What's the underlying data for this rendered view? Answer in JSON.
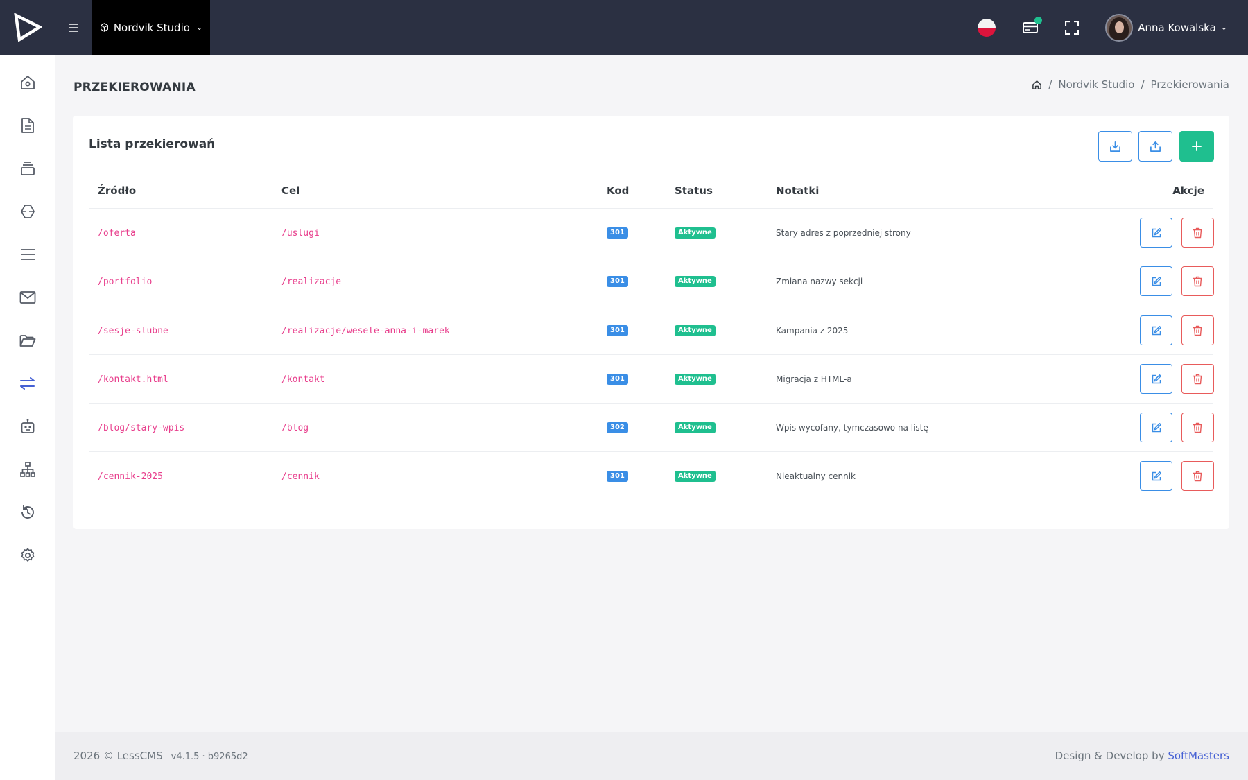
{
  "topbar": {
    "site_name": "Nordvik Studio",
    "user_name": "Anna Kowalska",
    "icons": [
      "logo-icon",
      "menu-icon",
      "cube-icon",
      "flag-pl-icon",
      "card-icon",
      "fullscreen-icon",
      "chevron-down-icon"
    ],
    "accent": "#1fbf8f"
  },
  "sidebar": {
    "items": [
      {
        "name": "home"
      },
      {
        "name": "pages"
      },
      {
        "name": "layers"
      },
      {
        "name": "modules"
      },
      {
        "name": "menu"
      },
      {
        "name": "mail"
      },
      {
        "name": "files"
      },
      {
        "name": "redirects",
        "active": true
      },
      {
        "name": "robot"
      },
      {
        "name": "sitemap"
      },
      {
        "name": "history"
      },
      {
        "name": "settings"
      }
    ]
  },
  "page": {
    "title": "PRZEKIEROWANIA",
    "breadcrumb": [
      "Nordvik Studio",
      "Przekierowania"
    ]
  },
  "card": {
    "title": "Lista przekierowań",
    "columns": [
      "Źródło",
      "Cel",
      "Kod",
      "Status",
      "Notatki",
      "Akcje"
    ],
    "rows": [
      {
        "source": "/oferta",
        "target": "/uslugi",
        "code": "301",
        "status": "Aktywne",
        "note": "Stary adres z poprzedniej strony"
      },
      {
        "source": "/portfolio",
        "target": "/realizacje",
        "code": "301",
        "status": "Aktywne",
        "note": "Zmiana nazwy sekcji"
      },
      {
        "source": "/sesje-slubne",
        "target": "/realizacje/wesele-anna-i-marek",
        "code": "301",
        "status": "Aktywne",
        "note": "Kampania z 2025"
      },
      {
        "source": "/kontakt.html",
        "target": "/kontakt",
        "code": "301",
        "status": "Aktywne",
        "note": "Migracja z HTML-a"
      },
      {
        "source": "/blog/stary-wpis",
        "target": "/blog",
        "code": "302",
        "status": "Aktywne",
        "note": "Wpis wycofany, tymczasowo na listę"
      },
      {
        "source": "/cennik-2025",
        "target": "/cennik",
        "code": "301",
        "status": "Aktywne",
        "note": "Nieaktualny cennik"
      }
    ]
  },
  "footer": {
    "copyright": "2026 © LessCMS",
    "version": "v4.1.5 · b9265d2",
    "credit_prefix": "Design & Develop by",
    "credit_link": "SoftMasters"
  },
  "colors": {
    "topbar": "#2b3042",
    "primary": "#3a8ee6",
    "success": "#1fbf8f",
    "danger": "#e85b5b",
    "code_text": "#e83e8c"
  }
}
